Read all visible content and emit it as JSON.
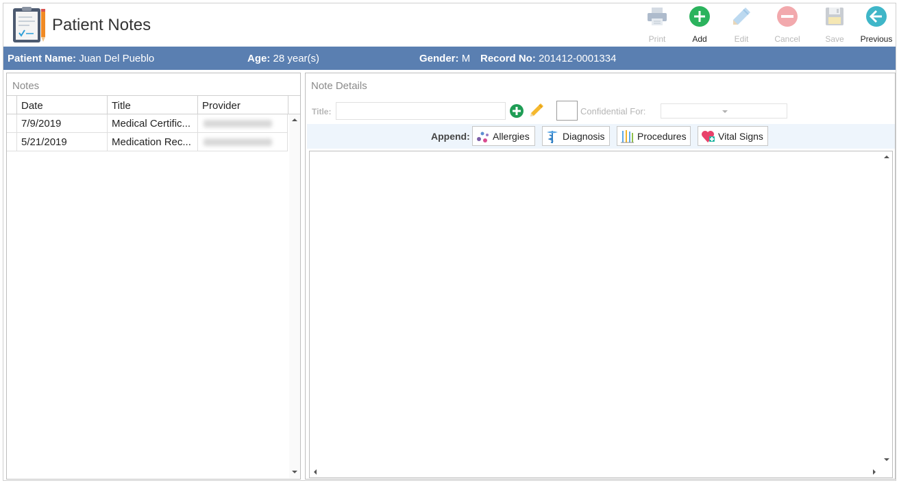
{
  "app": {
    "title": "Patient Notes"
  },
  "toolbar": {
    "print": "Print",
    "add": "Add",
    "edit": "Edit",
    "cancel": "Cancel",
    "save": "Save",
    "previous": "Previous"
  },
  "patient": {
    "name_label": "Patient Name:",
    "name": "Juan Del Pueblo",
    "age_label": "Age:",
    "age": "28 year(s)",
    "gender_label": "Gender:",
    "gender": "M",
    "record_label": "Record No:",
    "record": "201412-0001334"
  },
  "notes": {
    "title": "Notes",
    "columns": [
      "Date",
      "Title",
      "Provider"
    ],
    "rows": [
      {
        "date": "7/9/2019",
        "title": "Medical Certific..."
      },
      {
        "date": "5/21/2019",
        "title": "Medication Rec..."
      }
    ]
  },
  "details": {
    "title": "Note Details",
    "title_label": "Title:",
    "title_value": "",
    "confidential_label": "Confidential For:",
    "append_label": "Append:",
    "append_buttons": [
      "Allergies",
      "Diagnosis",
      "Procedures",
      "Vital Signs"
    ]
  },
  "colors": {
    "header_bar": "#5a7fb1",
    "add_green": "#2bb35d",
    "previous_teal": "#3fb6c8",
    "cancel_disabled": "#f2a9ad",
    "append_bar": "#eef5fc"
  },
  "icons": {
    "logo": "clipboard-pencil-icon",
    "print": "printer-icon",
    "add": "plus-circle-icon",
    "edit": "pencil-icon",
    "cancel": "minus-circle-icon",
    "save": "floppy-disk-icon",
    "previous": "arrow-left-circle-icon"
  }
}
